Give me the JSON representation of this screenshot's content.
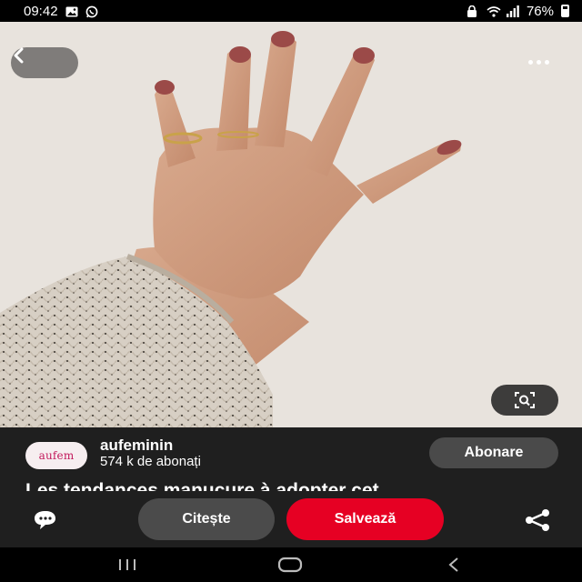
{
  "status_bar": {
    "time": "09:42",
    "battery": "76%",
    "icons": [
      "gallery-icon",
      "whatsapp-icon",
      "lock-icon",
      "wifi-icon",
      "signal-icon",
      "battery-icon"
    ]
  },
  "pin": {
    "image_description_icon": "hand-photo",
    "back_icon": "chevron-left-icon",
    "more_icon": "more-horizontal-icon",
    "lens_icon": "visual-search-icon"
  },
  "author": {
    "avatar_text": "aufem",
    "name": "aufeminin",
    "followers": "574 k de abonați",
    "follow_label": "Abonare"
  },
  "title": "Les tendances manucure à adopter cet",
  "actions": {
    "comment_icon": "comment-icon",
    "read_label": "Citește",
    "save_label": "Salvează",
    "share_icon": "share-icon"
  },
  "colors": {
    "save": "#e60023",
    "panel": "#1f1f1f",
    "button_gray": "#4b4b4b"
  }
}
